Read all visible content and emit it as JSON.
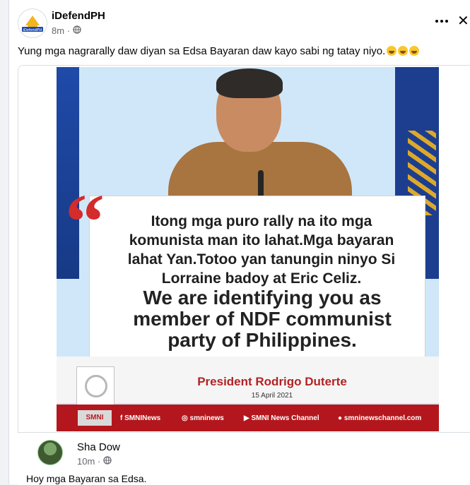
{
  "post": {
    "author": "iDefendPH",
    "time": "8m",
    "audience_icon": "globe-icon",
    "text": "Yung mga nagrarally daw diyan sa Edsa Bayaran daw kayo sabi ng tatay niyo.",
    "emojis": [
      "laughing-emoji",
      "laughing-emoji",
      "laughing-emoji"
    ],
    "more_icon": "more-icon",
    "close_icon": "close-icon"
  },
  "image": {
    "quote_mark": "“",
    "quote_lines": [
      "Itong mga puro rally na ito mga",
      "komunista man ito lahat.Mga bayaran",
      "lahat Yan.Totoo yan tanungin ninyo Si",
      "Lorraine badoy at Eric Celiz."
    ],
    "quote_english": [
      "We are identifying you as",
      "member of NDF communist",
      "party of Philippines."
    ],
    "speaker": "President Rodrigo Duterte",
    "date": "15 April 2021",
    "channel_logo": "SMNI",
    "socials": {
      "facebook": "SMNINews",
      "instagram": "smninews",
      "youtube": "SMNI News Channel",
      "website": "smninewschannel.com"
    }
  },
  "comment": {
    "author": "Sha Dow",
    "time": "10m",
    "text": "Hoy mga Bayaran sa Edsa."
  },
  "colors": {
    "brand_red": "#b3171d",
    "quote_red": "#d42b2b",
    "muted": "#65676b",
    "border": "#dadde1"
  }
}
